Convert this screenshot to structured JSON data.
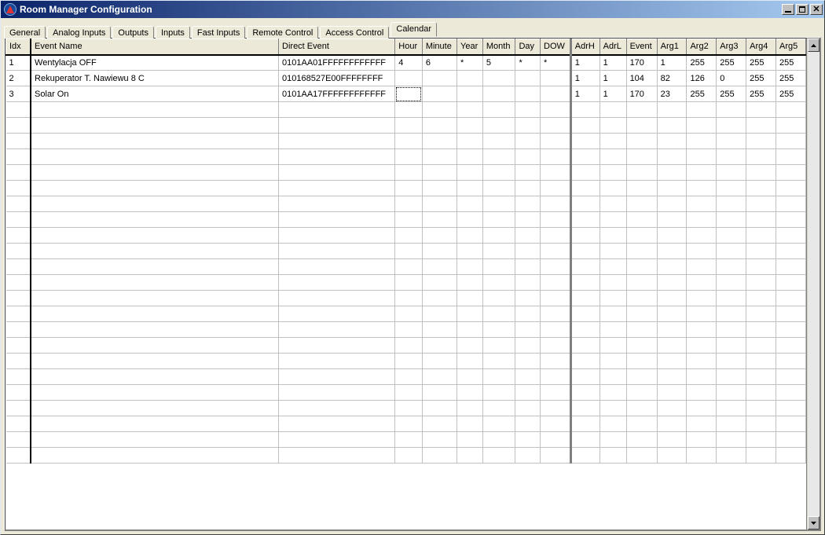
{
  "window": {
    "title": "Room Manager Configuration"
  },
  "tabs": [
    {
      "label": "General"
    },
    {
      "label": "Analog Inputs"
    },
    {
      "label": "Outputs"
    },
    {
      "label": "Inputs"
    },
    {
      "label": "Fast Inputs"
    },
    {
      "label": "Remote Control"
    },
    {
      "label": "Access Control"
    },
    {
      "label": "Calendar",
      "active": true
    }
  ],
  "columns": [
    {
      "key": "idx",
      "label": "Idx"
    },
    {
      "key": "name",
      "label": "Event Name"
    },
    {
      "key": "de",
      "label": "Direct Event"
    },
    {
      "key": "hour",
      "label": "Hour"
    },
    {
      "key": "min",
      "label": "Minute"
    },
    {
      "key": "year",
      "label": "Year"
    },
    {
      "key": "month",
      "label": "Month"
    },
    {
      "key": "day",
      "label": "Day"
    },
    {
      "key": "dow",
      "label": "DOW"
    },
    {
      "key": "adrh",
      "label": "AdrH"
    },
    {
      "key": "adrl",
      "label": "AdrL"
    },
    {
      "key": "event",
      "label": "Event"
    },
    {
      "key": "arg1",
      "label": "Arg1"
    },
    {
      "key": "arg2",
      "label": "Arg2"
    },
    {
      "key": "arg3",
      "label": "Arg3"
    },
    {
      "key": "arg4",
      "label": "Arg4"
    },
    {
      "key": "arg5",
      "label": "Arg5"
    }
  ],
  "rows": [
    {
      "idx": "1",
      "name": "Wentylacja OFF",
      "de": "0101AA01FFFFFFFFFFFF",
      "hour": "4",
      "min": "6",
      "year": "*",
      "month": "5",
      "day": "*",
      "dow": "*",
      "adrh": "1",
      "adrl": "1",
      "event": "170",
      "arg1": "1",
      "arg2": "255",
      "arg3": "255",
      "arg4": "255",
      "arg5": "255"
    },
    {
      "idx": "2",
      "name": "Rekuperator T. Nawiewu 8 C",
      "de": "010168527E00FFFFFFFF",
      "hour": "",
      "min": "",
      "year": "",
      "month": "",
      "day": "",
      "dow": "",
      "adrh": "1",
      "adrl": "1",
      "event": "104",
      "arg1": "82",
      "arg2": "126",
      "arg3": "0",
      "arg4": "255",
      "arg5": "255"
    },
    {
      "idx": "3",
      "name": "Solar On",
      "de": "0101AA17FFFFFFFFFFFF",
      "hour": "",
      "min": "",
      "year": "",
      "month": "",
      "day": "",
      "dow": "",
      "adrh": "1",
      "adrl": "1",
      "event": "170",
      "arg1": "23",
      "arg2": "255",
      "arg3": "255",
      "arg4": "255",
      "arg5": "255",
      "focus": "hour"
    }
  ],
  "blank_row_count": 23
}
